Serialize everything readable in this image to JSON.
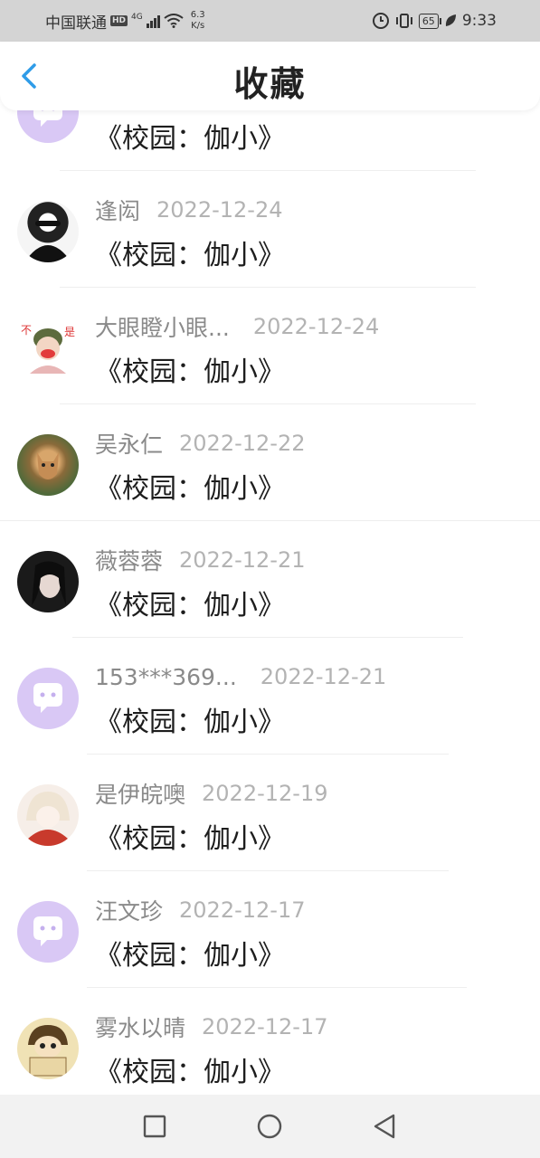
{
  "status_bar": {
    "carrier": "中国联通",
    "hd": "HD",
    "network": "4G",
    "speed_value": "6.3",
    "speed_unit": "K/s",
    "battery": "65",
    "time": "9:33"
  },
  "header": {
    "title": "收藏",
    "back_icon": "chevron-left-icon"
  },
  "colors": {
    "accent": "#2f9ce8",
    "avatar_default": "#d9c8f5",
    "name": "#8a8a8a",
    "date": "#b3b3b3",
    "work": "#1d1d1d"
  },
  "favorites": [
    {
      "name": "",
      "date": "",
      "work": "《校园：伽小》",
      "avatar": "default-chat-avatar"
    },
    {
      "name": "逢闳",
      "date": "2022-12-24",
      "work": "《校园：伽小》",
      "avatar": "photo-sunglasses-avatar"
    },
    {
      "name": "大眼瞪小眼...",
      "date": "2022-12-24",
      "work": "《校园：伽小》",
      "avatar": "cartoon-helmet-avatar"
    },
    {
      "name": "吴永仁",
      "date": "2022-12-22",
      "work": "《校园：伽小》",
      "avatar": "photo-cougar-avatar"
    },
    {
      "name": "薇蓉蓉",
      "date": "2022-12-21",
      "work": "《校园：伽小》",
      "avatar": "photo-girl-avatar"
    },
    {
      "name": "153***369...",
      "date": "2022-12-21",
      "work": "《校园：伽小》",
      "avatar": "default-chat-avatar"
    },
    {
      "name": "是伊皖噢",
      "date": "2022-12-19",
      "work": "《校园：伽小》",
      "avatar": "anime-girl-avatar"
    },
    {
      "name": "汪文珍",
      "date": "2022-12-17",
      "work": "《校园：伽小》",
      "avatar": "default-chat-avatar"
    },
    {
      "name": "雾水以晴",
      "date": "2022-12-17",
      "work": "《校园：伽小》",
      "avatar": "cartoon-sign-avatar"
    }
  ],
  "nav_bar": {
    "recents_icon": "square-icon",
    "home_icon": "circle-icon",
    "back_icon": "triangle-back-icon"
  }
}
